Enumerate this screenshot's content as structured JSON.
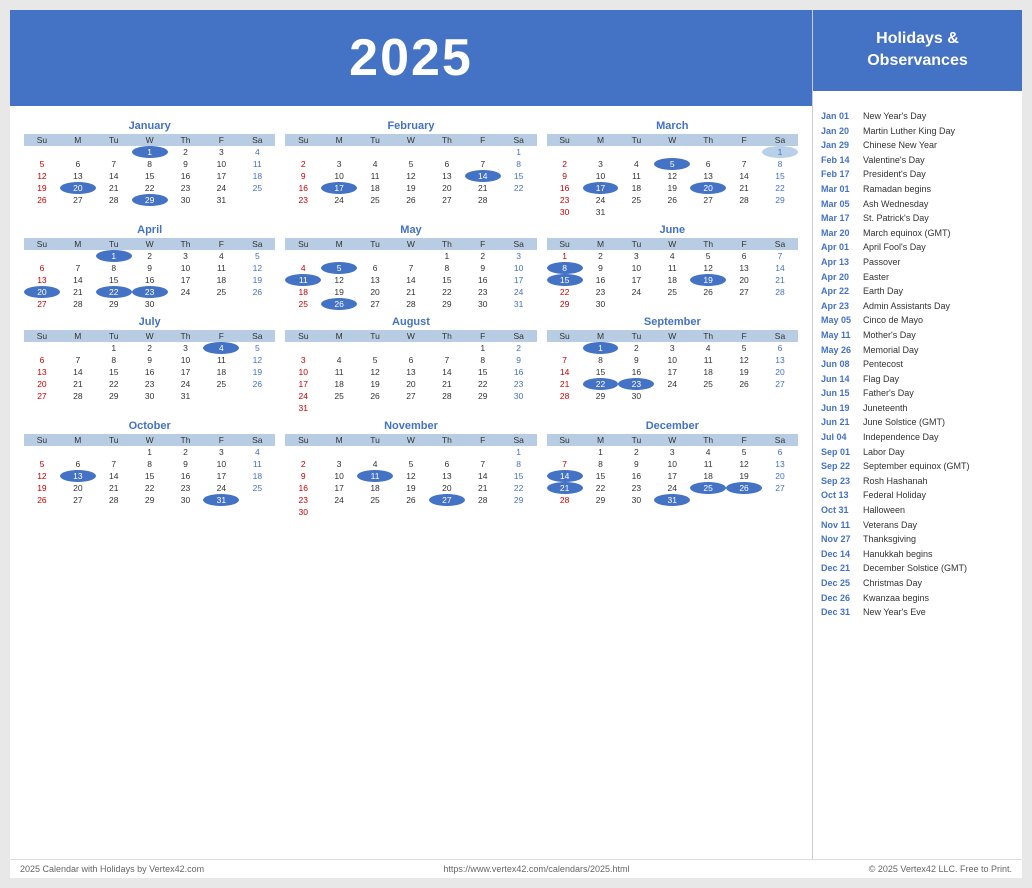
{
  "year": "2025",
  "sidebar_title": "Holidays &\nObservances",
  "footer": {
    "left": "2025 Calendar with Holidays by Vertex42.com",
    "center": "https://www.vertex42.com/calendars/2025.html",
    "right": "© 2025 Vertex42 LLC. Free to Print."
  },
  "holidays": [
    {
      "date": "Jan 01",
      "name": "New Year's Day"
    },
    {
      "date": "Jan 20",
      "name": "Martin Luther King Day"
    },
    {
      "date": "Jan 29",
      "name": "Chinese New Year"
    },
    {
      "date": "Feb 14",
      "name": "Valentine's Day"
    },
    {
      "date": "Feb 17",
      "name": "President's Day"
    },
    {
      "date": "Mar 01",
      "name": "Ramadan begins"
    },
    {
      "date": "Mar 05",
      "name": "Ash Wednesday"
    },
    {
      "date": "Mar 17",
      "name": "St. Patrick's Day"
    },
    {
      "date": "Mar 20",
      "name": "March equinox (GMT)"
    },
    {
      "date": "Apr 01",
      "name": "April Fool's Day"
    },
    {
      "date": "Apr 13",
      "name": "Passover"
    },
    {
      "date": "Apr 20",
      "name": "Easter"
    },
    {
      "date": "Apr 22",
      "name": "Earth Day"
    },
    {
      "date": "Apr 23",
      "name": "Admin Assistants Day"
    },
    {
      "date": "May 05",
      "name": "Cinco de Mayo"
    },
    {
      "date": "May 11",
      "name": "Mother's Day"
    },
    {
      "date": "May 26",
      "name": "Memorial Day"
    },
    {
      "date": "Jun 08",
      "name": "Pentecost"
    },
    {
      "date": "Jun 14",
      "name": "Flag Day"
    },
    {
      "date": "Jun 15",
      "name": "Father's Day"
    },
    {
      "date": "Jun 19",
      "name": "Juneteenth"
    },
    {
      "date": "Jun 21",
      "name": "June Solstice (GMT)"
    },
    {
      "date": "Jul 04",
      "name": "Independence Day"
    },
    {
      "date": "Sep 01",
      "name": "Labor Day"
    },
    {
      "date": "Sep 22",
      "name": "September equinox (GMT)"
    },
    {
      "date": "Sep 23",
      "name": "Rosh Hashanah"
    },
    {
      "date": "Oct 13",
      "name": "Federal Holiday"
    },
    {
      "date": "Oct 31",
      "name": "Halloween"
    },
    {
      "date": "Nov 11",
      "name": "Veterans Day"
    },
    {
      "date": "Nov 27",
      "name": "Thanksgiving"
    },
    {
      "date": "Dec 14",
      "name": "Hanukkah begins"
    },
    {
      "date": "Dec 21",
      "name": "December Solstice (GMT)"
    },
    {
      "date": "Dec 25",
      "name": "Christmas Day"
    },
    {
      "date": "Dec 26",
      "name": "Kwanzaa begins"
    },
    {
      "date": "Dec 31",
      "name": "New Year's Eve"
    }
  ],
  "months": {
    "january": {
      "name": "January",
      "weeks": [
        [
          null,
          null,
          null,
          "1h",
          "2",
          "3",
          "4"
        ],
        [
          "5",
          "6",
          "7",
          "8",
          "9",
          "10",
          "11"
        ],
        [
          "12",
          "13",
          "14",
          "15",
          "16",
          "17",
          "18"
        ],
        [
          "19",
          "20h",
          "21",
          "22",
          "23",
          "24",
          "25"
        ],
        [
          "26",
          "27",
          "28",
          "29h",
          "30",
          "31",
          null
        ]
      ]
    },
    "february": {
      "name": "February",
      "weeks": [
        [
          null,
          null,
          null,
          null,
          null,
          null,
          "1"
        ],
        [
          "2",
          "3",
          "4",
          "5",
          "6",
          "7",
          "8"
        ],
        [
          "9",
          "10",
          "11",
          "12",
          "13",
          "14h",
          "15"
        ],
        [
          "16",
          "17h",
          "18",
          "19",
          "20",
          "21",
          "22"
        ],
        [
          "23",
          "24",
          "25",
          "26",
          "27",
          "28",
          null
        ]
      ]
    },
    "march": {
      "name": "March",
      "weeks": [
        [
          null,
          null,
          null,
          null,
          null,
          null,
          "1s"
        ],
        [
          "2",
          "3",
          "4",
          "5h",
          "6",
          "7",
          "8"
        ],
        [
          "9",
          "10",
          "11",
          "12",
          "13",
          "14",
          "15"
        ],
        [
          "16",
          "17h",
          "18",
          "19",
          "20h",
          "21",
          "22"
        ],
        [
          "23",
          "24",
          "25",
          "26",
          "27",
          "28",
          "29"
        ],
        [
          "30",
          "31",
          null,
          null,
          null,
          null,
          null
        ]
      ]
    },
    "april": {
      "name": "April",
      "weeks": [
        [
          null,
          null,
          "1h",
          "2",
          "3",
          "4",
          "5"
        ],
        [
          "6",
          "7",
          "8",
          "9",
          "10",
          "11",
          "12"
        ],
        [
          "13",
          "14",
          "15",
          "16",
          "17",
          "18",
          "19"
        ],
        [
          "20h",
          "21",
          "22h",
          "23h",
          "24",
          "25",
          "26"
        ],
        [
          "27",
          "28",
          "29",
          "30",
          null,
          null,
          null
        ]
      ]
    },
    "may": {
      "name": "May",
      "weeks": [
        [
          null,
          null,
          null,
          null,
          "1",
          "2",
          "3"
        ],
        [
          "4",
          "5h",
          "6",
          "7",
          "8",
          "9",
          "10"
        ],
        [
          "11h",
          "12",
          "13",
          "14",
          "15",
          "16",
          "17"
        ],
        [
          "18",
          "19",
          "20",
          "21",
          "22",
          "23",
          "24"
        ],
        [
          "25",
          "26h",
          "27",
          "28",
          "29",
          "30",
          "31"
        ]
      ]
    },
    "june": {
      "name": "June",
      "weeks": [
        [
          "1",
          "2",
          "3",
          "4",
          "5",
          "6",
          "7"
        ],
        [
          "8h",
          "9",
          "10",
          "11",
          "12",
          "13",
          "14"
        ],
        [
          "15h",
          "16",
          "17",
          "18",
          "19h",
          "20",
          "21"
        ],
        [
          "22",
          "23",
          "24",
          "25",
          "26",
          "27",
          "28"
        ],
        [
          "29",
          "30",
          null,
          null,
          null,
          null,
          null
        ]
      ]
    },
    "july": {
      "name": "July",
      "weeks": [
        [
          null,
          null,
          "1",
          "2",
          "3",
          "4h",
          "5"
        ],
        [
          "6",
          "7",
          "8",
          "9",
          "10",
          "11",
          "12"
        ],
        [
          "13",
          "14",
          "15",
          "16",
          "17",
          "18",
          "19"
        ],
        [
          "20",
          "21",
          "22",
          "23",
          "24",
          "25",
          "26"
        ],
        [
          "27",
          "28",
          "29",
          "30",
          "31",
          null,
          null
        ]
      ]
    },
    "august": {
      "name": "August",
      "weeks": [
        [
          null,
          null,
          null,
          null,
          null,
          "1",
          "2"
        ],
        [
          "3",
          "4",
          "5",
          "6",
          "7",
          "8",
          "9"
        ],
        [
          "10",
          "11",
          "12",
          "13",
          "14",
          "15",
          "16"
        ],
        [
          "17",
          "18",
          "19",
          "20",
          "21",
          "22",
          "23"
        ],
        [
          "24",
          "25",
          "26",
          "27",
          "28",
          "29",
          "30"
        ],
        [
          "31",
          null,
          null,
          null,
          null,
          null,
          null
        ]
      ]
    },
    "september": {
      "name": "September",
      "weeks": [
        [
          null,
          "1h",
          "2",
          "3",
          "4",
          "5",
          "6"
        ],
        [
          "7",
          "8",
          "9",
          "10",
          "11",
          "12",
          "13"
        ],
        [
          "14",
          "15",
          "16",
          "17",
          "18",
          "19",
          "20"
        ],
        [
          "21",
          "22h",
          "23h",
          "24",
          "25",
          "26",
          "27"
        ],
        [
          "28",
          "29",
          "30",
          null,
          null,
          null,
          null
        ]
      ]
    },
    "october": {
      "name": "October",
      "weeks": [
        [
          null,
          null,
          null,
          "1",
          "2",
          "3",
          "4"
        ],
        [
          "5",
          "6",
          "7",
          "8",
          "9",
          "10",
          "11"
        ],
        [
          "12",
          "13h",
          "14",
          "15",
          "16",
          "17",
          "18"
        ],
        [
          "19",
          "20",
          "21",
          "22",
          "23",
          "24",
          "25"
        ],
        [
          "26",
          "27",
          "28",
          "29",
          "30",
          "31h",
          null
        ]
      ]
    },
    "november": {
      "name": "November",
      "weeks": [
        [
          null,
          null,
          null,
          null,
          null,
          null,
          "1"
        ],
        [
          "2",
          "3",
          "4",
          "5",
          "6",
          "7",
          "8"
        ],
        [
          "9",
          "10",
          "11h",
          "12",
          "13",
          "14",
          "15"
        ],
        [
          "16",
          "17",
          "18",
          "19",
          "20",
          "21",
          "22"
        ],
        [
          "23",
          "24",
          "25",
          "26",
          "27h",
          "28",
          "29"
        ],
        [
          "30",
          null,
          null,
          null,
          null,
          null,
          null
        ]
      ]
    },
    "december": {
      "name": "December",
      "weeks": [
        [
          null,
          "1",
          "2",
          "3",
          "4",
          "5",
          "6"
        ],
        [
          "7",
          "8",
          "9",
          "10",
          "11",
          "12",
          "13"
        ],
        [
          "14h",
          "15",
          "16",
          "17",
          "18",
          "19",
          "20"
        ],
        [
          "21h",
          "22",
          "23",
          "24",
          "25h",
          "26h",
          "27"
        ],
        [
          "28",
          "29",
          "30",
          "31h",
          null,
          null,
          null
        ]
      ]
    }
  }
}
